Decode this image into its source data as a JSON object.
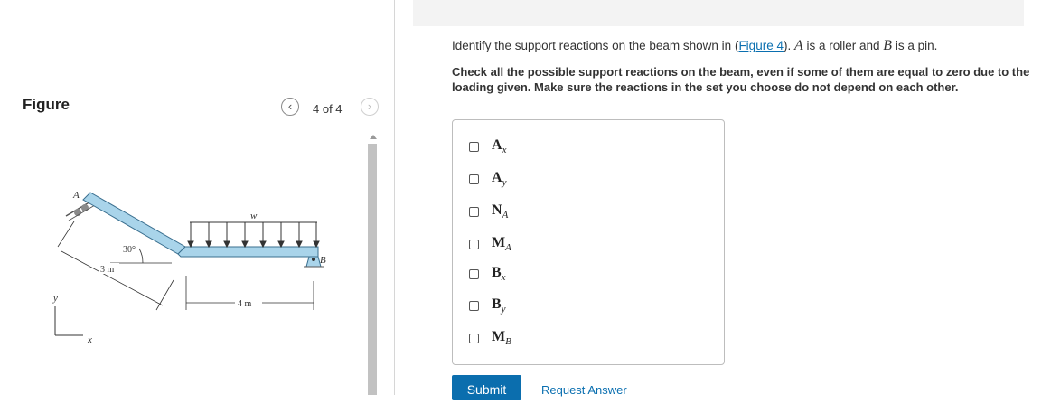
{
  "figure_panel": {
    "title": "Figure",
    "prev_icon": "chevron-left-icon",
    "next_icon": "chevron-right-icon",
    "counter": "4 of 4",
    "labels": {
      "point_a": "A",
      "point_b": "B",
      "load": "w",
      "angle": "30°",
      "length_incline": "3 m",
      "length_horizontal": "4 m",
      "axis_y": "y",
      "axis_x": "x"
    }
  },
  "question": {
    "intro_before": "Identify the support reactions on the beam shown in (",
    "figure_link": "Figure 4",
    "intro_mid": "). ",
    "var_a": "A",
    "intro_roller": " is a roller and ",
    "var_b": "B",
    "intro_pin": " is a pin.",
    "instruction": "Check all the possible support reactions on the beam, even if some of them are equal to zero due to the loading given. Make sure the reactions in the set you choose do not depend on each other."
  },
  "options": [
    {
      "base": "A",
      "sub": "x"
    },
    {
      "base": "A",
      "sub": "y"
    },
    {
      "base": "N",
      "sub": "A"
    },
    {
      "base": "M",
      "sub": "A"
    },
    {
      "base": "B",
      "sub": "x"
    },
    {
      "base": "B",
      "sub": "y"
    },
    {
      "base": "M",
      "sub": "B"
    }
  ],
  "actions": {
    "submit": "Submit",
    "request_answer": "Request Answer"
  },
  "colors": {
    "beam_fill": "#a9d4ea",
    "accent_blue": "#0b6eae",
    "link": "#0a6fb0"
  }
}
